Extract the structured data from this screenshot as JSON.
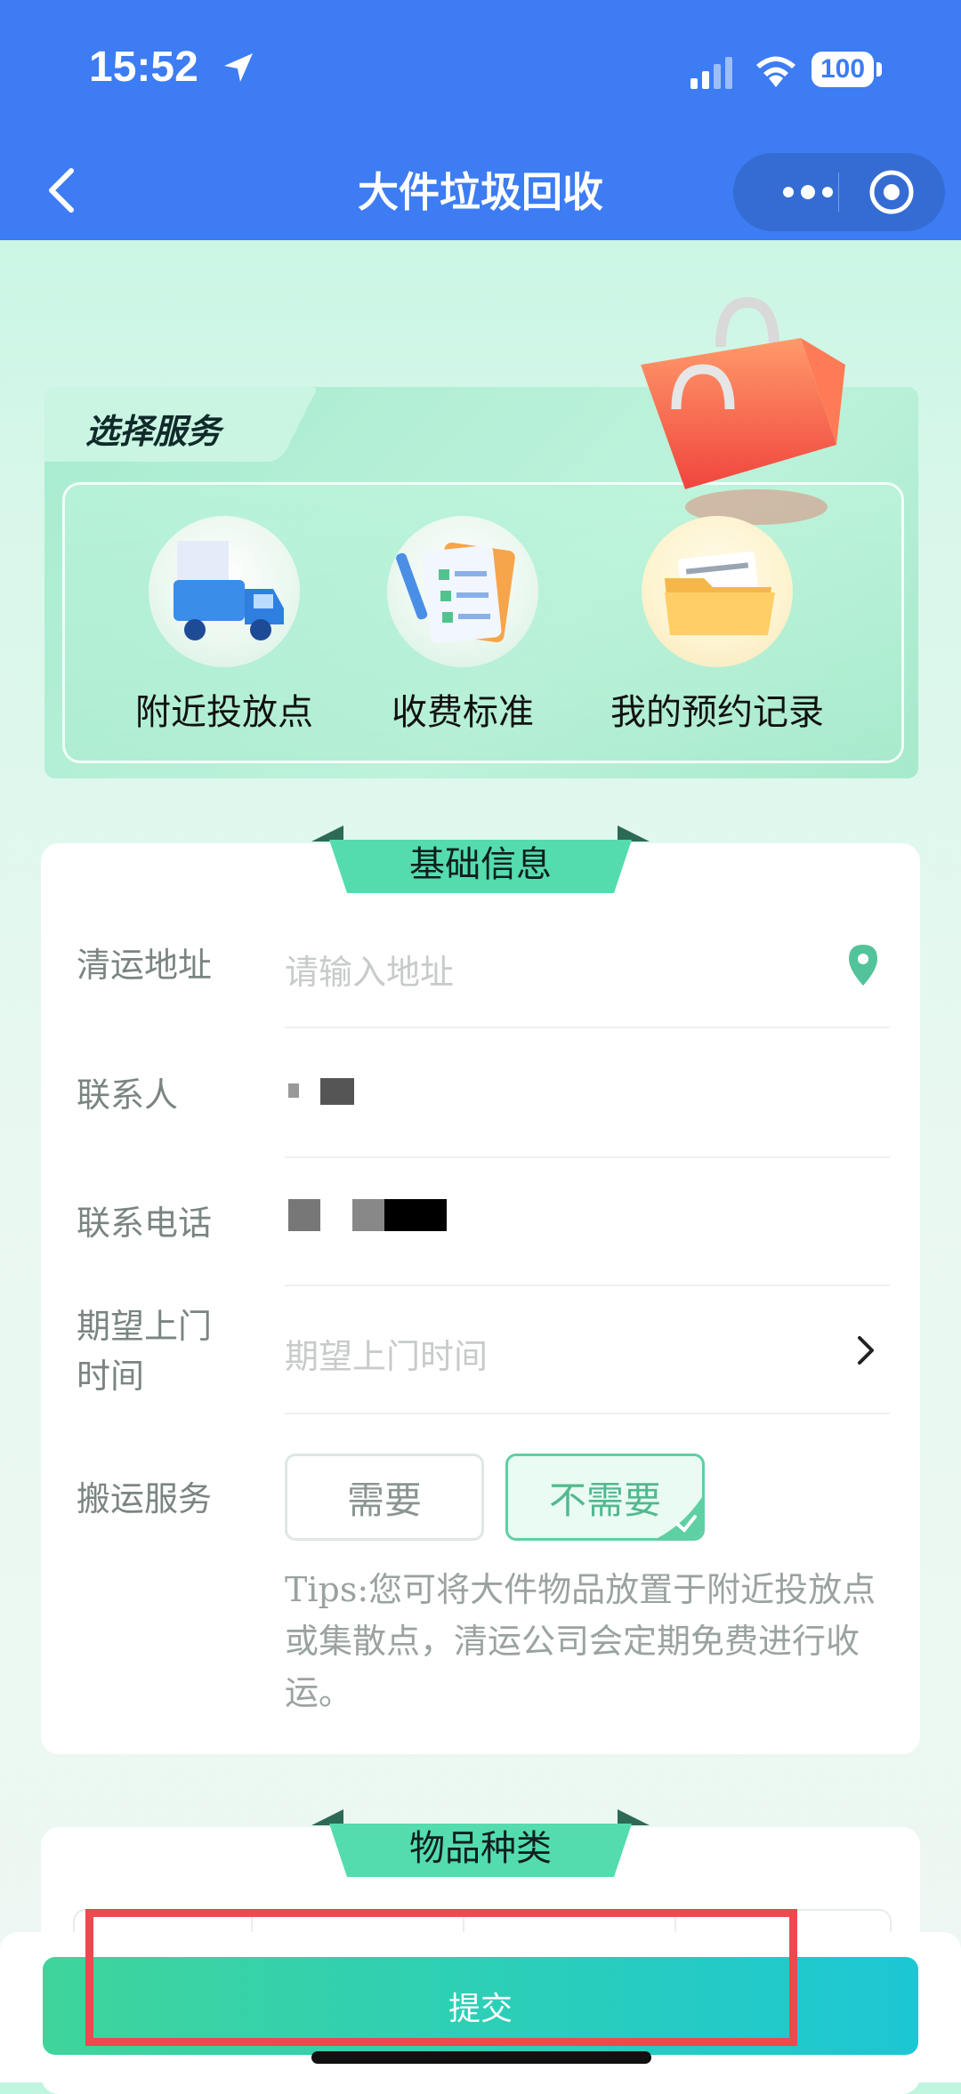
{
  "status_bar": {
    "time": "15:52",
    "battery": "100"
  },
  "nav": {
    "title": "大件垃圾回收"
  },
  "service": {
    "title": "选择服务",
    "items": [
      {
        "label": "附近投放点",
        "icon": "truck-icon"
      },
      {
        "label": "收费标准",
        "icon": "checklist-icon"
      },
      {
        "label": "我的预约记录",
        "icon": "folder-icon"
      }
    ]
  },
  "basic_info": {
    "section_title": "基础信息",
    "address": {
      "label": "清运地址",
      "placeholder": "请输入地址"
    },
    "contact": {
      "label": "联系人"
    },
    "phone": {
      "label": "联系电话"
    },
    "visit_time": {
      "label_line1": "期望上门",
      "label_line2": "时间",
      "placeholder": "期望上门时间"
    },
    "carry": {
      "label": "搬运服务",
      "option_need": "需要",
      "option_noneed": "不需要",
      "selected": "不需要"
    },
    "tips": "Tips:您可将大件物品放置于附近投放点或集散点，清运公司会定期免费进行收运。"
  },
  "category": {
    "section_title": "物品种类"
  },
  "footer": {
    "submit_label": "提交"
  },
  "colors": {
    "nav_blue": "#3d7cf2",
    "accent_green": "#52b88f",
    "highlight_red": "#ec4a4f"
  }
}
